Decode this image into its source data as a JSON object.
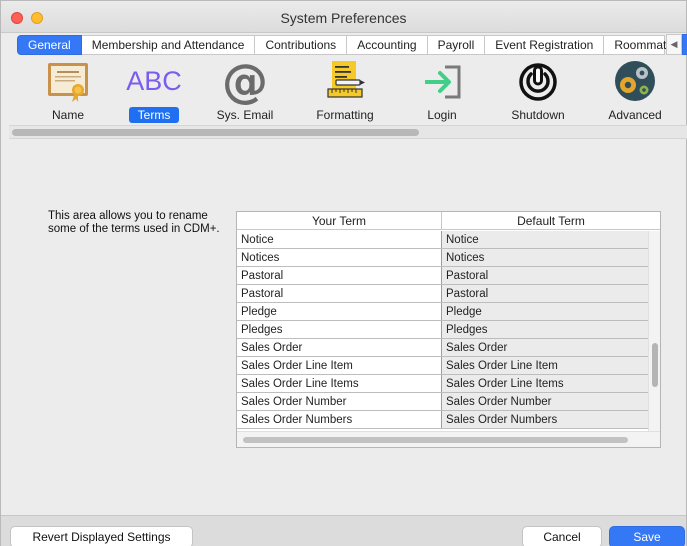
{
  "window": {
    "title": "System Preferences"
  },
  "tabs": [
    {
      "label": "General",
      "active": true
    },
    {
      "label": "Membership and Attendance",
      "active": false
    },
    {
      "label": "Contributions",
      "active": false
    },
    {
      "label": "Accounting",
      "active": false
    },
    {
      "label": "Payroll",
      "active": false
    },
    {
      "label": "Event Registration",
      "active": false
    },
    {
      "label": "Roommate",
      "active": false
    }
  ],
  "toolbar": {
    "items": [
      {
        "label": "Name",
        "icon": "certificate-icon",
        "selected": false
      },
      {
        "label": "Terms",
        "icon": "abc-icon",
        "selected": true,
        "icon_text": "ABC"
      },
      {
        "label": "Sys. Email",
        "icon": "at-sign-icon",
        "selected": false
      },
      {
        "label": "Formatting",
        "icon": "notepad-ruler-icon",
        "selected": false
      },
      {
        "label": "Login",
        "icon": "login-arrow-icon",
        "selected": false
      },
      {
        "label": "Shutdown",
        "icon": "power-icon",
        "selected": false
      },
      {
        "label": "Advanced",
        "icon": "gears-icon",
        "selected": false
      }
    ]
  },
  "description": "This area allows you to rename some of the terms used in CDM+.",
  "terms_table": {
    "columns": [
      "Your Term",
      "Default Term"
    ],
    "rows": [
      [
        "Notice",
        "Notice"
      ],
      [
        "Notices",
        "Notices"
      ],
      [
        "Pastoral",
        "Pastoral"
      ],
      [
        "Pastoral",
        "Pastoral"
      ],
      [
        "Pledge",
        "Pledge"
      ],
      [
        "Pledges",
        "Pledges"
      ],
      [
        "Sales Order",
        "Sales Order"
      ],
      [
        "Sales Order Line Item",
        "Sales Order Line Item"
      ],
      [
        "Sales Order Line Items",
        "Sales Order Line Items"
      ],
      [
        "Sales Order Number",
        "Sales Order Number"
      ],
      [
        "Sales Order Numbers",
        "Sales Order Numbers"
      ]
    ]
  },
  "buttons": {
    "revert": "Revert Displayed Settings",
    "cancel": "Cancel",
    "save": "Save"
  },
  "colors": {
    "accent": "#3478f6",
    "close": "#fe5f57",
    "minimize": "#febc2e"
  }
}
